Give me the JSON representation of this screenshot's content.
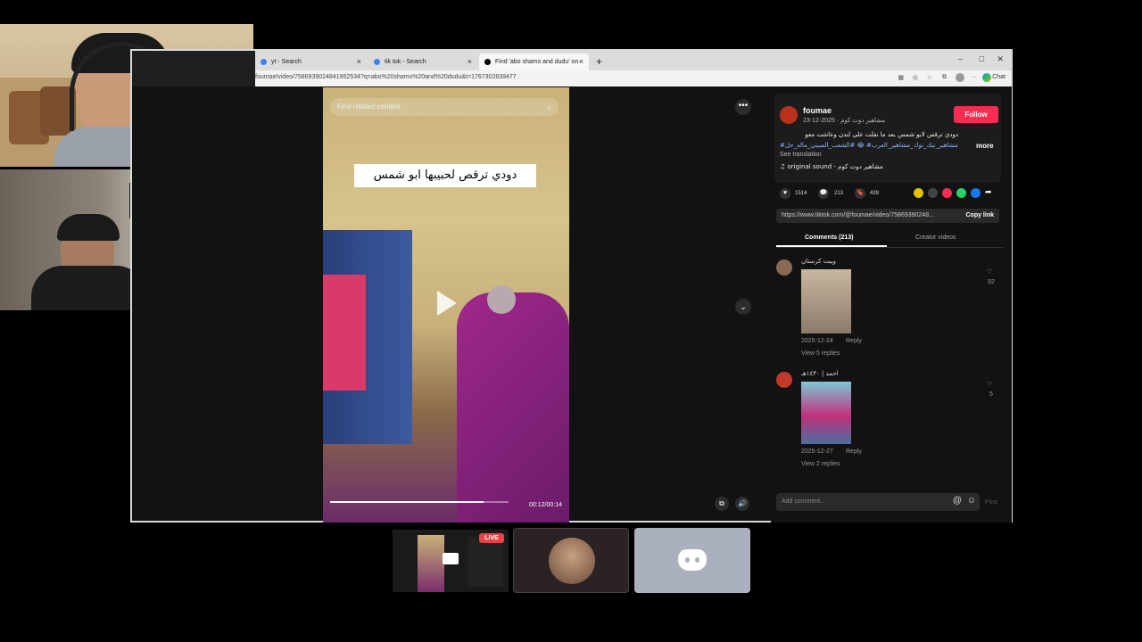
{
  "browser": {
    "tabs": [
      {
        "label": "yt - Search"
      },
      {
        "label": "tik tok - Search"
      },
      {
        "label": "Find 'abo shams and dudu' on TikT"
      }
    ],
    "new_tab": "+",
    "url": "foumae/video/7586939024841952534?q=abo%20shams%20and%20dudu&t=1767302839477",
    "chat_label": "Chat"
  },
  "video": {
    "search_placeholder": "Find related content",
    "caption": "دودي ترقص لحبيبها ابو شمس",
    "time": "00:12/00:14",
    "progress": 0.86
  },
  "post": {
    "username": "foumae",
    "subtitle": "مشاهير دوت كوم · 2025-12-23",
    "follow_label": "Follow",
    "description": "دودي ترقص لابو شمس بعد ما نقلت على لندن وعاشت معو",
    "hashtags": "#مشاهير_تيك_توك_مشاهير_العرب# 😂 #الشعب_الصيني_ماله_حل",
    "more_label": "more",
    "see_translation": "See translation",
    "sound": "original sound - مشاهير دوت كوم",
    "likes": "1514",
    "comments_count": "213",
    "saves": "439",
    "link": "https://www.tiktok.com/@foumae/video/75869390248...",
    "copy_link": "Copy link",
    "tab_comments": "Comments (213)",
    "tab_creator": "Creator videos"
  },
  "comments": [
    {
      "user": "ويبت كرستان",
      "date": "2025-12-24",
      "reply": "Reply",
      "view_replies": "View 5 replies",
      "likes": "92"
    },
    {
      "user": "احمد | ١٤٣٠هـ",
      "date": "2025-12-27",
      "reply": "Reply",
      "view_replies": "View 2 replies",
      "likes": "5"
    }
  ],
  "comment_input": {
    "placeholder": "Add comment...",
    "post": "Post"
  },
  "discord": {
    "live_badge": "LIVE"
  }
}
